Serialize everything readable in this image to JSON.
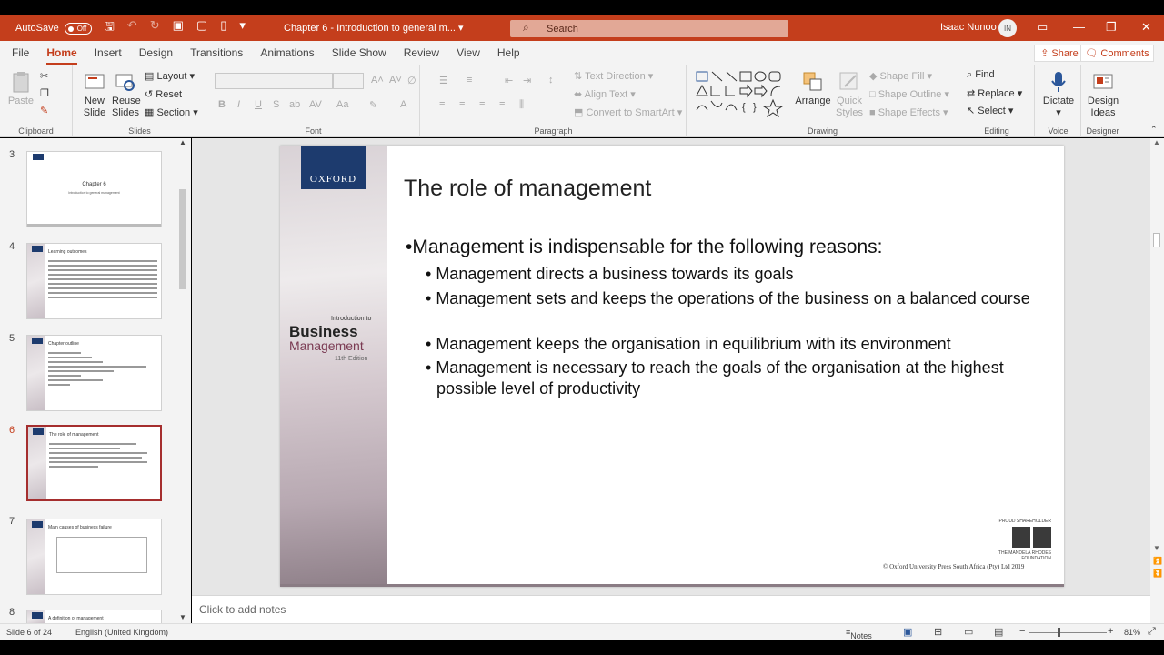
{
  "titlebar": {
    "autosave_label": "AutoSave",
    "autosave_state": "Off",
    "doc_title": "Chapter 6 - Introduction to general m...",
    "search_placeholder": "Search",
    "user_name": "Isaac Nunoo",
    "user_initials": "IN",
    "brand_color": "#c43e1c"
  },
  "menu": {
    "tabs": [
      "File",
      "Home",
      "Insert",
      "Design",
      "Transitions",
      "Animations",
      "Slide Show",
      "Review",
      "View",
      "Help"
    ],
    "active": "Home",
    "share": "Share",
    "comments": "Comments"
  },
  "ribbon": {
    "clipboard": {
      "label": "Clipboard",
      "paste": "Paste"
    },
    "slides": {
      "label": "Slides",
      "new_slide": "New",
      "new_slide2": "Slide",
      "reuse": "Reuse",
      "reuse2": "Slides",
      "layout": "Layout",
      "reset": "Reset",
      "section": "Section"
    },
    "font": {
      "label": "Font"
    },
    "paragraph": {
      "label": "Paragraph",
      "text_direction": "Text Direction",
      "align_text": "Align Text",
      "smartart": "Convert to SmartArt"
    },
    "drawing": {
      "label": "Drawing",
      "arrange": "Arrange",
      "quick_styles": "Quick",
      "quick_styles2": "Styles",
      "shape_fill": "Shape Fill",
      "shape_outline": "Shape Outline",
      "shape_effects": "Shape Effects"
    },
    "editing": {
      "label": "Editing",
      "find": "Find",
      "replace": "Replace",
      "select": "Select"
    },
    "voice": {
      "label": "Voice",
      "dictate": "Dictate"
    },
    "designer": {
      "label": "Designer",
      "design_ideas": "Design",
      "design_ideas2": "Ideas"
    }
  },
  "thumbnails": [
    {
      "num": "3",
      "title": "Chapter 6",
      "sub": "Introduction to general management"
    },
    {
      "num": "4",
      "title": "Learning outcomes"
    },
    {
      "num": "5",
      "title": "Chapter outline"
    },
    {
      "num": "6",
      "title": "The role of management"
    },
    {
      "num": "7",
      "title": "Main causes of business failure"
    },
    {
      "num": "8",
      "title": "A definition of management"
    }
  ],
  "slide": {
    "publisher": "OXFORD",
    "book_intro": "Introduction to",
    "book_title": "Business",
    "book_subtitle": "Management",
    "book_edition": "11th Edition",
    "title": "The role of management",
    "bullet_main": "Management is indispensable for the following reasons:",
    "sub_bullets": [
      "Management directs a business towards its goals",
      "Management sets and keeps the operations of the business on a balanced course",
      "Management keeps the organisation in equilibrium with its environment",
      "Management is necessary to reach the goals of the organisation at the highest possible level of productivity"
    ],
    "sponsor_line1": "PROUD SHAREHOLDER",
    "sponsor_line2": "THE MANDELA RHODES",
    "sponsor_line3": "FOUNDATION",
    "copyright": "© Oxford University Press South Africa (Pty) Ltd 2019"
  },
  "notes_placeholder": "Click to add notes",
  "status": {
    "slide_count": "Slide 6 of 24",
    "language": "English (United Kingdom)",
    "notes": "Notes",
    "zoom": "81%"
  }
}
